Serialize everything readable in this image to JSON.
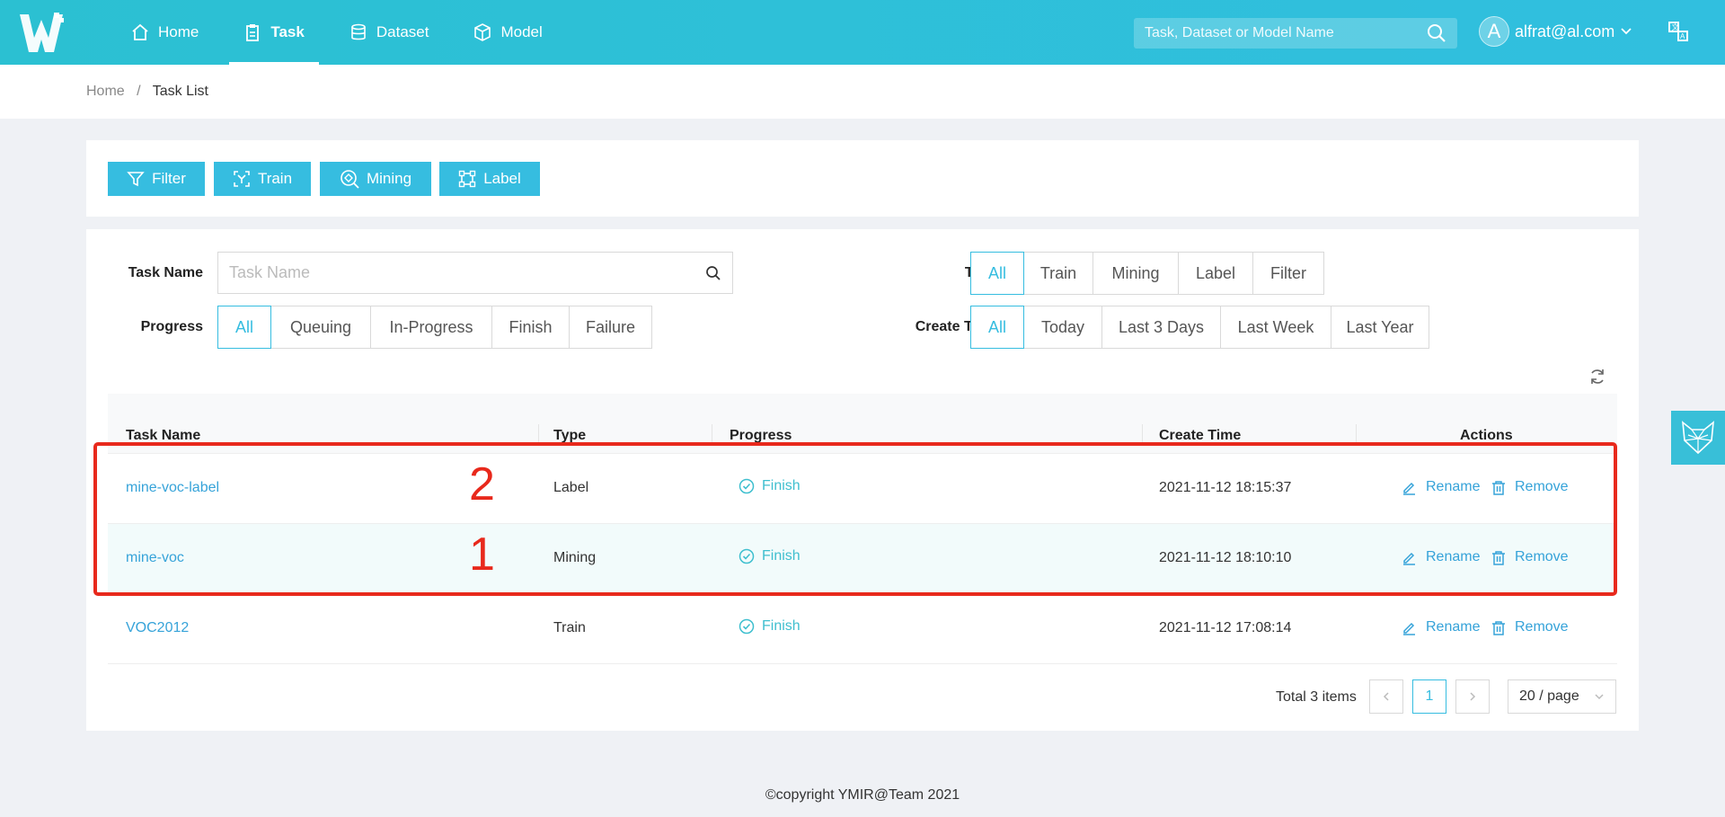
{
  "header": {
    "nav": [
      {
        "label": "Home",
        "icon": "home-icon"
      },
      {
        "label": "Task",
        "icon": "clipboard-icon",
        "active": true
      },
      {
        "label": "Dataset",
        "icon": "database-icon"
      },
      {
        "label": "Model",
        "icon": "cube-icon"
      }
    ],
    "search_placeholder": "Task, Dataset or Model Name",
    "avatar_letter": "A",
    "user_email": "alfrat@al.com"
  },
  "breadcrumb": {
    "home": "Home",
    "separator": "/",
    "current": "Task List"
  },
  "actions": [
    {
      "label": "Filter",
      "icon": "filter-icon"
    },
    {
      "label": "Train",
      "icon": "train-icon"
    },
    {
      "label": "Mining",
      "icon": "mining-icon"
    },
    {
      "label": "Label",
      "icon": "label-icon"
    }
  ],
  "filters": {
    "task_name_label": "Task Name",
    "task_name_placeholder": "Task Name",
    "type_label": "Type",
    "type_options": [
      "All",
      "Train",
      "Mining",
      "Label",
      "Filter"
    ],
    "progress_label": "Progress",
    "progress_options": [
      "All",
      "Queuing",
      "In-Progress",
      "Finish",
      "Failure"
    ],
    "create_time_label": "Create Time",
    "create_time_options": [
      "All",
      "Today",
      "Last 3 Days",
      "Last Week",
      "Last Year"
    ]
  },
  "table": {
    "columns": [
      "Task Name",
      "Type",
      "Progress",
      "Create Time",
      "Actions"
    ],
    "rows": [
      {
        "name": "mine-voc-label",
        "type": "Label",
        "progress": "Finish",
        "create_time": "2021-11-12 18:15:37",
        "annotation": "2"
      },
      {
        "name": "mine-voc",
        "type": "Mining",
        "progress": "Finish",
        "create_time": "2021-11-12 18:10:10",
        "annotation": "1"
      },
      {
        "name": "VOC2012",
        "type": "Train",
        "progress": "Finish",
        "create_time": "2021-11-12 17:08:14",
        "annotation": ""
      }
    ],
    "rename_label": "Rename",
    "remove_label": "Remove"
  },
  "pagination": {
    "total": "Total 3 items",
    "current_page": "1",
    "page_size": "20 / page"
  },
  "footer": "©copyright YMIR@Team 2021",
  "colors": {
    "accent": "#36bde0",
    "header": "#2bc0d2",
    "link": "#36a3d9",
    "annotation": "#e8291c"
  }
}
